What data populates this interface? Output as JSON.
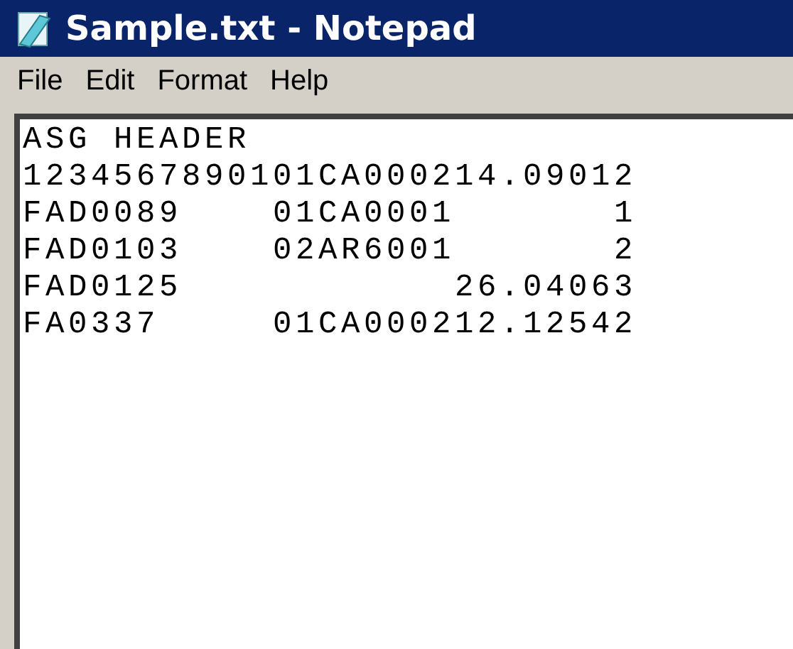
{
  "window": {
    "title": "Sample.txt - Notepad"
  },
  "menu": [
    {
      "label": "File"
    },
    {
      "label": "Edit"
    },
    {
      "label": "Format"
    },
    {
      "label": "Help"
    }
  ],
  "editor": {
    "lines": [
      "ASG HEADER",
      "1234567890101CA000214.09012",
      "FAD0089    01CA0001       1",
      "FAD0103    02AR6001       2",
      "FAD0125            26.04063",
      "FA0337     01CA000212.12542"
    ]
  }
}
